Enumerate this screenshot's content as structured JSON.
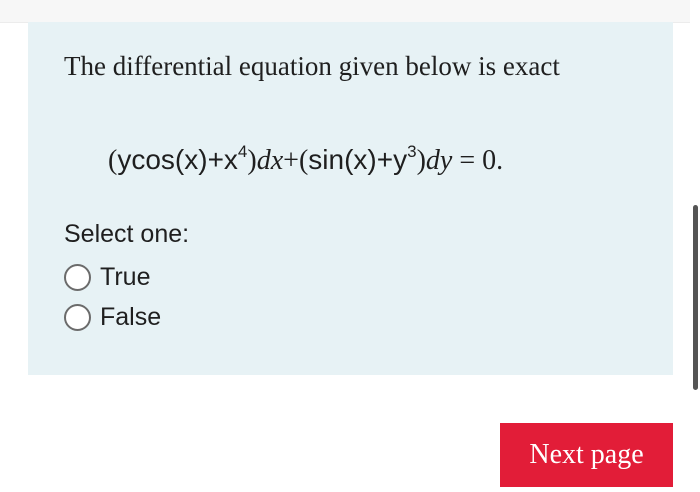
{
  "question": {
    "text": "The differential equation given below is exact"
  },
  "equation": {
    "open1": "(",
    "y": "y",
    "cos": "cos",
    "arg1": "(x)",
    "plus1": "+",
    "x": "x",
    "exp4": "4",
    "close1": ")",
    "dx": "dx",
    "plus2": "+",
    "open2": "(",
    "sin": "sin",
    "arg2": "(x)",
    "plus3": "+",
    "y2": "y",
    "exp3": "3",
    "close2": ")",
    "dy": "dy",
    "equals": " = ",
    "zero": "0."
  },
  "select": {
    "label": "Select one:"
  },
  "options": [
    {
      "label": "True"
    },
    {
      "label": "False"
    }
  ],
  "navigation": {
    "next_label": "Next page"
  },
  "colors": {
    "panel_bg": "#e7f2f5",
    "button_bg": "#e21d38"
  }
}
